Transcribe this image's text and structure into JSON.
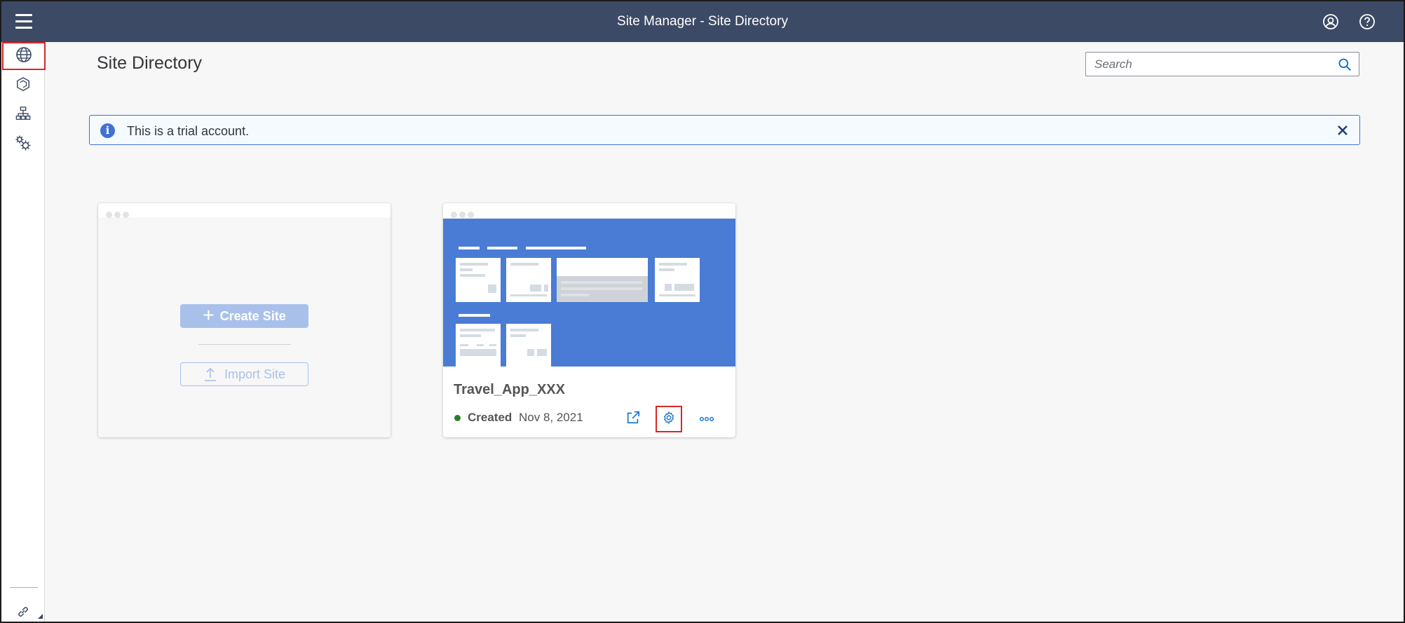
{
  "shell": {
    "title": "Site Manager - Site Directory"
  },
  "sidebar": {
    "items": [
      {
        "name": "site-directory",
        "icon": "globe-icon"
      },
      {
        "name": "content-manager",
        "icon": "cube-icon"
      },
      {
        "name": "provider-manager",
        "icon": "hierarchy-icon"
      },
      {
        "name": "settings",
        "icon": "gears-icon"
      }
    ],
    "footer_icon": "link-icon"
  },
  "main": {
    "title": "Site Directory",
    "search": {
      "placeholder": "Search",
      "value": ""
    },
    "banner": {
      "message": "This is a trial account."
    },
    "new_site_card": {
      "create_label": "Create Site",
      "import_label": "Import Site"
    },
    "sites": [
      {
        "name": "Travel_App_XXX",
        "status": "Created",
        "date": "Nov 8, 2021"
      }
    ]
  },
  "colors": {
    "shell": "#3c4a65",
    "accent": "#3e73d3",
    "preview": "#4a7cd5",
    "status_ok": "#2b7d2b",
    "highlight": "#d62828"
  }
}
